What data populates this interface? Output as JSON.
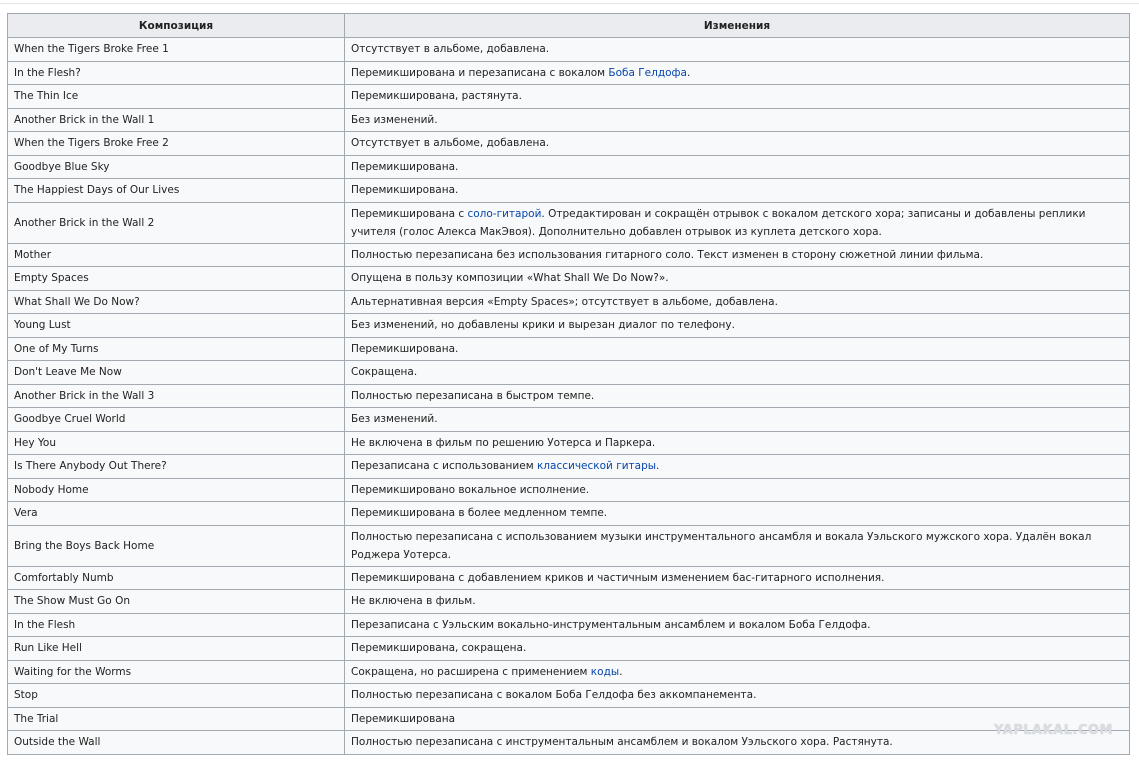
{
  "table": {
    "headers": [
      "Композиция",
      "Изменения"
    ],
    "rows": [
      {
        "song": "When the Tigers Broke Free 1",
        "change": [
          {
            "t": "Отсутствует в альбоме, добавлена."
          }
        ]
      },
      {
        "song": "In the Flesh?",
        "change": [
          {
            "t": "Перемикширована и перезаписана с вокалом "
          },
          {
            "t": "Боба Гелдофа",
            "link": true
          },
          {
            "t": "."
          }
        ]
      },
      {
        "song": "The Thin Ice",
        "change": [
          {
            "t": "Перемикширована, растянута."
          }
        ]
      },
      {
        "song": "Another Brick in the Wall 1",
        "change": [
          {
            "t": "Без изменений."
          }
        ]
      },
      {
        "song": "When the Tigers Broke Free 2",
        "change": [
          {
            "t": "Отсутствует в альбоме, добавлена."
          }
        ]
      },
      {
        "song": "Goodbye Blue Sky",
        "change": [
          {
            "t": "Перемикширована."
          }
        ]
      },
      {
        "song": "The Happiest Days of Our Lives",
        "change": [
          {
            "t": "Перемикширована."
          }
        ]
      },
      {
        "song": "Another Brick in the Wall 2",
        "tall": true,
        "change": [
          {
            "t": "Перемикширована с "
          },
          {
            "t": "соло-гитарой",
            "link": true
          },
          {
            "t": ". Отредактирован и сокращён отрывок с вокалом детского хора; записаны и добавлены реплики учителя (голос Алекса МакЭвоя). Дополнительно добавлен отрывок из куплета детского хора."
          }
        ]
      },
      {
        "song": "Mother",
        "change": [
          {
            "t": "Полностью перезаписана без использования гитарного соло. Текст изменен в сторону сюжетной линии фильма."
          }
        ]
      },
      {
        "song": "Empty Spaces",
        "change": [
          {
            "t": "Опущена в пользу композиции «What Shall We Do Now?»."
          }
        ]
      },
      {
        "song": "What Shall We Do Now?",
        "change": [
          {
            "t": "Альтернативная версия «Empty Spaces»; отсутствует в альбоме, добавлена."
          }
        ]
      },
      {
        "song": "Young Lust",
        "change": [
          {
            "t": "Без изменений, но добавлены крики и вырезан диалог по телефону."
          }
        ]
      },
      {
        "song": "One of My Turns",
        "change": [
          {
            "t": "Перемикширована."
          }
        ]
      },
      {
        "song": "Don't Leave Me Now",
        "change": [
          {
            "t": "Сокращена."
          }
        ]
      },
      {
        "song": "Another Brick in the Wall 3",
        "change": [
          {
            "t": "Полностью перезаписана в быстром темпе."
          }
        ]
      },
      {
        "song": "Goodbye Cruel World",
        "change": [
          {
            "t": "Без изменений."
          }
        ]
      },
      {
        "song": "Hey You",
        "change": [
          {
            "t": "Не включена в фильм по решению Уотерса и Паркера."
          }
        ]
      },
      {
        "song": "Is There Anybody Out There?",
        "change": [
          {
            "t": "Перезаписана с использованием "
          },
          {
            "t": "классической гитары",
            "link": true
          },
          {
            "t": "."
          }
        ]
      },
      {
        "song": "Nobody Home",
        "change": [
          {
            "t": "Перемикшировано вокальное исполнение."
          }
        ]
      },
      {
        "song": "Vera",
        "change": [
          {
            "t": "Перемикширована в более медленном темпе."
          }
        ]
      },
      {
        "song": "Bring the Boys Back Home",
        "tall": true,
        "change": [
          {
            "t": "Полностью перезаписана с использованием музыки инструментального ансамбля и вокала Уэльского мужского хора. Удалён вокал Роджера Уотерса."
          }
        ]
      },
      {
        "song": "Comfortably Numb",
        "change": [
          {
            "t": "Перемикширована с добавлением криков и частичным изменением бас-гитарного исполнения."
          }
        ]
      },
      {
        "song": "The Show Must Go On",
        "change": [
          {
            "t": "Не включена в фильм."
          }
        ]
      },
      {
        "song": "In the Flesh",
        "change": [
          {
            "t": "Перезаписана с Уэльским вокально-инструментальным ансамблем и вокалом Боба Гелдофа."
          }
        ]
      },
      {
        "song": "Run Like Hell",
        "change": [
          {
            "t": "Перемикширована, сокращена."
          }
        ]
      },
      {
        "song": "Waiting for the Worms",
        "change": [
          {
            "t": "Сокращена, но расширена с применением "
          },
          {
            "t": "коды",
            "link": true
          },
          {
            "t": "."
          }
        ]
      },
      {
        "song": "Stop",
        "change": [
          {
            "t": "Полностью перезаписана с вокалом Боба Гелдофа без аккомпанемента."
          }
        ]
      },
      {
        "song": "The Trial",
        "change": [
          {
            "t": "Перемикширована"
          }
        ]
      },
      {
        "song": "Outside the Wall",
        "change": [
          {
            "t": "Полностью перезаписана с инструментальным ансамблем и вокалом Уэльского хора. Растянута."
          }
        ]
      }
    ]
  },
  "watermark": "YAPLAKAL.COM",
  "colors": {
    "link": "#0645ad",
    "header_bg": "#eaecf0",
    "cell_bg": "#f8f9fa",
    "border": "#a2a9b1"
  }
}
